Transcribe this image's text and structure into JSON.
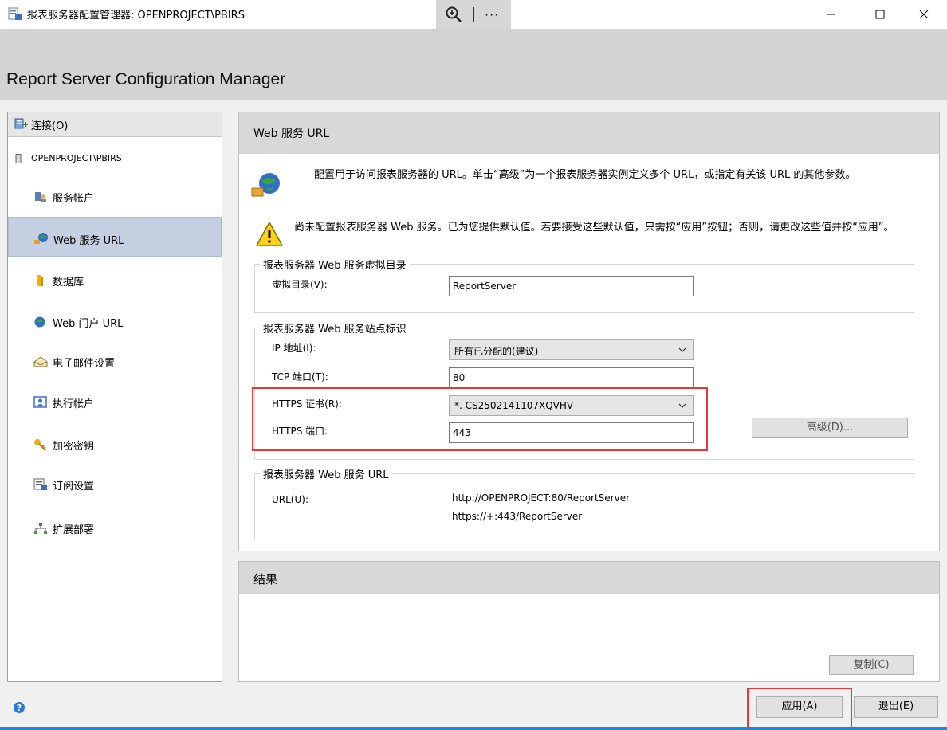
{
  "window": {
    "title": "报表服务器配置管理器: OPENPROJECT\\PBIRS",
    "more_label": "···"
  },
  "app_title": "Report Server Configuration Manager",
  "nav": {
    "connect_label": "连接(O)",
    "server_name": "OPENPROJECT\\PBIRS",
    "items": [
      {
        "label": "服务帐户",
        "icon": "service-account-icon"
      },
      {
        "label": "Web 服务 URL",
        "icon": "web-service-icon",
        "active": true
      },
      {
        "label": "数据库",
        "icon": "database-icon"
      },
      {
        "label": "Web 门户 URL",
        "icon": "web-portal-icon"
      },
      {
        "label": "电子邮件设置",
        "icon": "email-icon"
      },
      {
        "label": "执行帐户",
        "icon": "execution-account-icon"
      },
      {
        "label": "加密密钥",
        "icon": "encryption-key-icon"
      },
      {
        "label": "订阅设置",
        "icon": "subscription-icon"
      },
      {
        "label": "扩展部署",
        "icon": "scale-out-icon"
      }
    ]
  },
  "main": {
    "title": "Web 服务 URL",
    "info_text": "配置用于访问报表服务器的 URL。单击“高级”为一个报表服务器实例定义多个 URL，或指定有关该 URL 的其他参数。",
    "warning_text": "尚未配置报表服务器 Web 服务。已为您提供默认值。若要接受这些默认值，只需按“应用”按钮；否则，请更改这些值并按“应用”。",
    "vdir_group": {
      "legend": "报表服务器 Web 服务虚拟目录",
      "label": "虚拟目录(V):",
      "value": "ReportServer"
    },
    "site_group": {
      "legend": "报表服务器 Web 服务站点标识",
      "ip_label": "IP 地址(I):",
      "ip_value": "所有已分配的(建议)",
      "tcp_label": "TCP 端口(T):",
      "tcp_value": "80",
      "cert_label": "HTTPS 证书(R):",
      "cert_value": "*.            CS2502141107XQVHV",
      "https_port_label": "HTTPS 端口:",
      "https_port_value": "443",
      "advanced_button": "高级(D)..."
    },
    "url_group": {
      "legend": "报表服务器 Web 服务 URL",
      "label": "URL(U):",
      "urls": [
        "http://OPENPROJECT:80/ReportServer",
        "https://+:443/ReportServer"
      ]
    }
  },
  "results": {
    "title": "结果",
    "copy_button": "复制(C)"
  },
  "footer": {
    "apply_button": "应用(A)",
    "exit_button": "退出(E)"
  },
  "colors": {
    "nav_active": "#c4d0e2",
    "highlight": "#e23a3a",
    "accent_line": "#1e88d0"
  }
}
